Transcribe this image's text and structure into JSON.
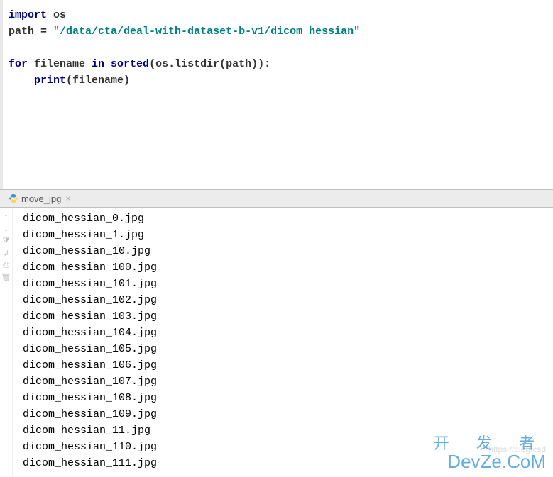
{
  "code": {
    "line1_import": "import",
    "line1_module": " os",
    "line2_var": "path ",
    "line2_op": "= ",
    "line2_string_prefix": "\"/data/cta/deal-with-dataset-b-v1/",
    "line2_string_suffix": "dicom_hessian",
    "line2_string_quote": "\"",
    "line4_for": "for",
    "line4_var": " filename ",
    "line4_in": "in",
    "line4_sorted": " sorted",
    "line4_rest": "(os.listdir(path)):",
    "line5_indent": "    ",
    "line5_print": "print",
    "line5_args": "(filename)"
  },
  "tab": {
    "name": "move_jpg"
  },
  "output": [
    "dicom_hessian_0.jpg",
    "dicom_hessian_1.jpg",
    "dicom_hessian_10.jpg",
    "dicom_hessian_100.jpg",
    "dicom_hessian_101.jpg",
    "dicom_hessian_102.jpg",
    "dicom_hessian_103.jpg",
    "dicom_hessian_104.jpg",
    "dicom_hessian_105.jpg",
    "dicom_hessian_106.jpg",
    "dicom_hessian_107.jpg",
    "dicom_hessian_108.jpg",
    "dicom_hessian_109.jpg",
    "dicom_hessian_11.jpg",
    "dicom_hessian_110.jpg",
    "dicom_hessian_111.jpg"
  ],
  "watermark": {
    "top": "开 发 者",
    "bottom": "DevZe.CoM",
    "url": "https://blog.csd"
  }
}
